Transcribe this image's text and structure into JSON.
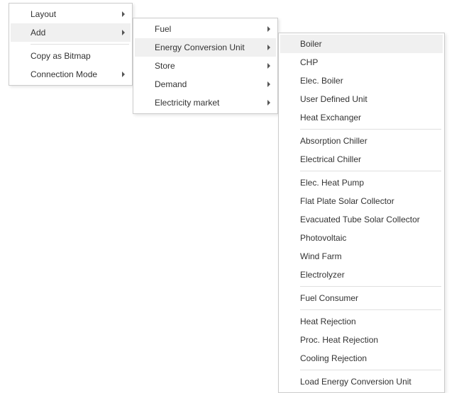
{
  "menu1": {
    "items": [
      {
        "label": "Layout",
        "submenu": true,
        "highlighted": false
      },
      {
        "label": "Add",
        "submenu": true,
        "highlighted": true
      },
      {
        "label": "Copy as Bitmap",
        "submenu": false,
        "highlighted": false,
        "sepBefore": true
      },
      {
        "label": "Connection Mode",
        "submenu": true,
        "highlighted": false
      }
    ]
  },
  "menu2": {
    "items": [
      {
        "label": "Fuel",
        "submenu": true,
        "highlighted": false
      },
      {
        "label": "Energy Conversion Unit",
        "submenu": true,
        "highlighted": true
      },
      {
        "label": "Store",
        "submenu": true,
        "highlighted": false
      },
      {
        "label": "Demand",
        "submenu": true,
        "highlighted": false
      },
      {
        "label": "Electricity market",
        "submenu": true,
        "highlighted": false
      }
    ]
  },
  "menu3": {
    "items": [
      {
        "label": "Boiler",
        "highlighted": true
      },
      {
        "label": "CHP"
      },
      {
        "label": "Elec. Boiler"
      },
      {
        "label": "User Defined Unit"
      },
      {
        "label": "Heat Exchanger"
      },
      {
        "label": "Absorption Chiller",
        "sepBefore": true
      },
      {
        "label": "Electrical Chiller"
      },
      {
        "label": "Elec. Heat Pump",
        "sepBefore": true
      },
      {
        "label": "Flat Plate Solar Collector"
      },
      {
        "label": "Evacuated Tube Solar Collector"
      },
      {
        "label": "Photovoltaic"
      },
      {
        "label": "Wind Farm"
      },
      {
        "label": "Electrolyzer"
      },
      {
        "label": "Fuel Consumer",
        "sepBefore": true
      },
      {
        "label": "Heat Rejection",
        "sepBefore": true
      },
      {
        "label": "Proc. Heat Rejection"
      },
      {
        "label": "Cooling Rejection"
      },
      {
        "label": "Load Energy Conversion Unit",
        "sepBefore": true
      }
    ]
  }
}
